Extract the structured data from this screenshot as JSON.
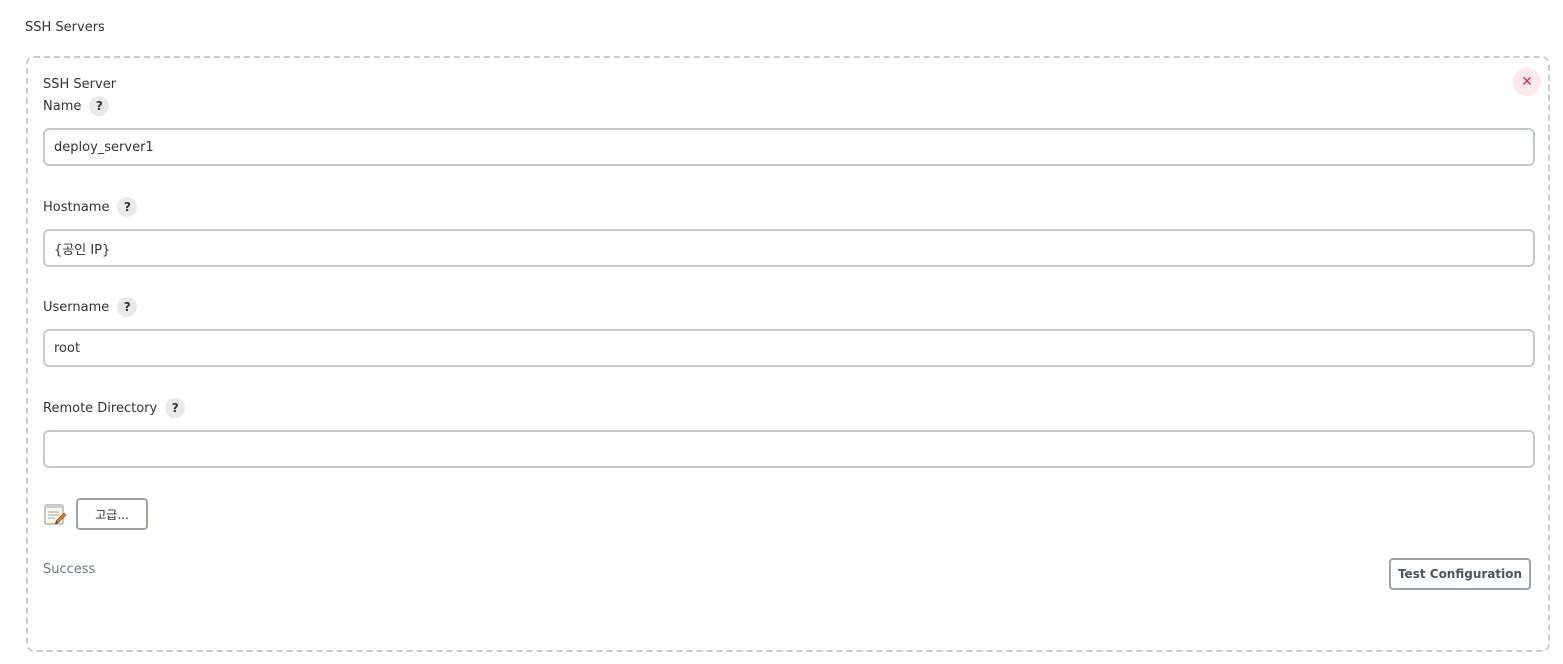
{
  "section": {
    "title": "SSH Servers"
  },
  "server": {
    "title": "SSH Server",
    "close_icon": "close-icon",
    "fields": {
      "name": {
        "label": "Name",
        "value": "deploy_server1"
      },
      "hostname": {
        "label": "Hostname",
        "value": "{공인 IP}"
      },
      "username": {
        "label": "Username",
        "value": "root"
      },
      "remote_directory": {
        "label": "Remote Directory",
        "value": ""
      }
    },
    "help_label": "?",
    "advanced_label": "고급...",
    "status": "Success",
    "test_label": "Test Configuration"
  },
  "colors": {
    "close_bg": "#fde8ec",
    "close_fg": "#d3304b",
    "status_text": "#6d7884",
    "input_border": "#c3cacf"
  }
}
